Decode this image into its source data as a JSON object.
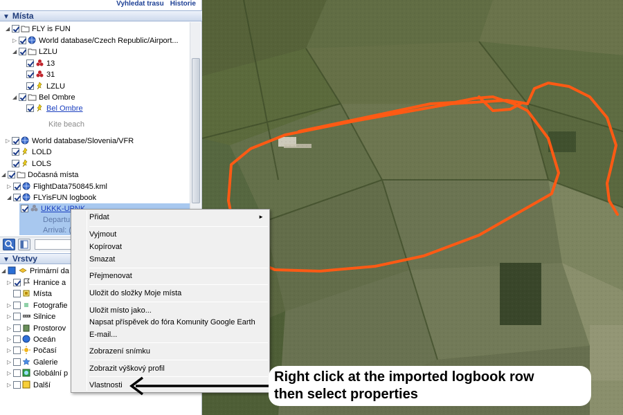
{
  "header_links": [
    "Vyhledat trasu",
    "Historie"
  ],
  "places_panel": {
    "title": "Místa",
    "items": [
      {
        "label": "FLY is FUN"
      },
      {
        "label": "World database/Czech Republic/Airport..."
      },
      {
        "label": "LZLU"
      },
      {
        "label": "13"
      },
      {
        "label": "31"
      },
      {
        "label": "LZLU"
      },
      {
        "label": "Bel Ombre"
      },
      {
        "label": "Bel Ombre"
      },
      {
        "label": "Kite beach"
      },
      {
        "label": "World database/Slovenia/VFR"
      },
      {
        "label": "LOLD"
      },
      {
        "label": "LOLS"
      },
      {
        "label": "Dočasná místa"
      },
      {
        "label": "FlightData750845.kml"
      },
      {
        "label": "FLYisFUN logbook"
      },
      {
        "label": "UKKK-UPNK"
      },
      {
        "label": "Departu"
      },
      {
        "label": "Arrival: ("
      }
    ]
  },
  "layers_panel": {
    "title": "Vrstvy",
    "items": [
      {
        "label": "Primární da"
      },
      {
        "label": "Hranice a"
      },
      {
        "label": "Místa"
      },
      {
        "label": "Fotografie"
      },
      {
        "label": "Silnice"
      },
      {
        "label": "Prostorov"
      },
      {
        "label": "Oceán"
      },
      {
        "label": "Počasí"
      },
      {
        "label": "Galerie"
      },
      {
        "label": "Globální p"
      },
      {
        "label": "Další"
      }
    ]
  },
  "context_menu": {
    "items": [
      {
        "label": "Přidat",
        "submenu": true
      },
      {
        "label": "Vyjmout"
      },
      {
        "label": "Kopírovat"
      },
      {
        "label": "Smazat"
      },
      {
        "label": "Přejmenovat"
      },
      {
        "label": "Uložit do složky Moje místa"
      },
      {
        "label": "Uložit místo jako..."
      },
      {
        "label": "Napsat příspěvek do fóra Komunity Google Earth"
      },
      {
        "label": "E-mail..."
      },
      {
        "label": "Zobrazení snímku"
      },
      {
        "label": "Zobrazit výškový profil"
      },
      {
        "label": "Vlastnosti"
      }
    ]
  },
  "callout": {
    "line1": "Right click at the imported logbook row",
    "line2": "then select properties"
  },
  "colors": {
    "track": "#ff5a14",
    "panel_header_text": "#1e3b7a",
    "selection": "#a8c8ef",
    "link": "#1a3fbf"
  }
}
